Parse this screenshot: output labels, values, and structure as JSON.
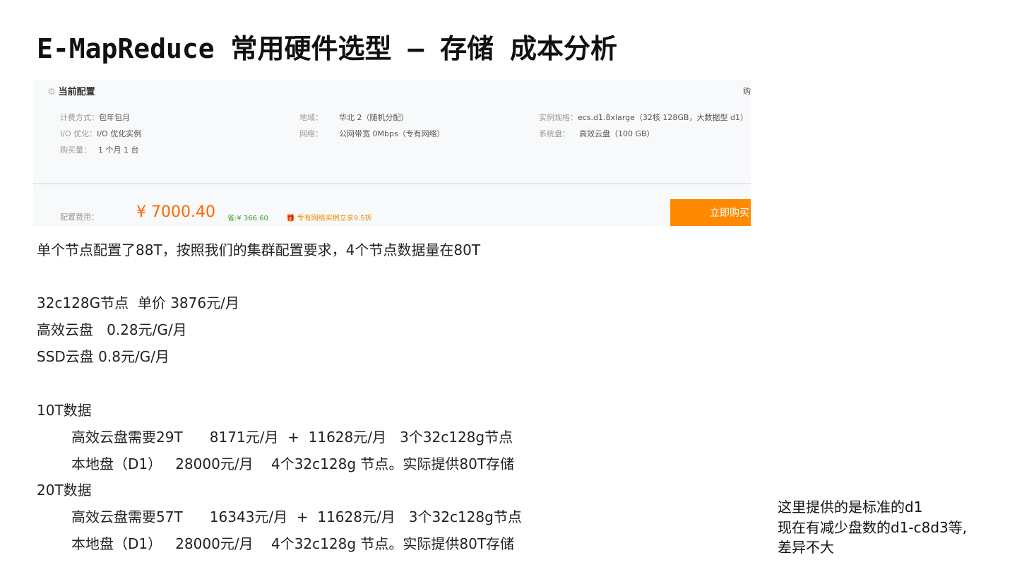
{
  "title": "E-MapReduce 常用硬件选型 – 存储 成本分析",
  "config": {
    "header": "当前配置",
    "billing_label": "计费方式：",
    "billing_value": "包年包月",
    "io_label": "I/O 优化：",
    "io_value": "I/O 优化实例",
    "qty_label": "购买量：",
    "qty_value": "1 个月 1 台",
    "region_label": "地域：",
    "region_value": "华北 2（随机分配）",
    "network_label": "网络：",
    "network_value": "公网带宽 0Mbps（专有网络）",
    "spec_label": "实例规格：",
    "spec_value": "ecs.d1.8xlarge（32核 128GB，大数据型 d1）",
    "sysdisk_label": "系统盘：",
    "sysdisk_value": "高效云盘（100 GB）",
    "buy_right": "购",
    "fee_label": "配置费用：",
    "price": "¥ 7000.40",
    "save": "省:¥ 366.60",
    "promo": "专有网络实例立享9.5折",
    "buy_button": "立即购买"
  },
  "lines": [
    "单个节点配置了88T，按照我们的集群配置要求，4个节点数据量在80T",
    "32c128G节点  单价 3876元/月",
    "高效云盘   0.28元/G/月",
    "SSD云盘 0.8元/G/月",
    "10T数据",
    "高效云盘需要29T      8171元/月  +  11628元/月   3个32c128g节点",
    "本地盘（D1）   28000元/月    4个32c128g 节点。实际提供80T存储",
    "20T数据",
    "高效云盘需要57T      16343元/月  +  11628元/月   3个32c128g节点",
    "本地盘（D1）   28000元/月    4个32c128g 节点。实际提供80T存储"
  ],
  "note": [
    "这里提供的是标准的d1",
    "现在有减少盘数的d1-c8d3等,",
    "差异不大"
  ]
}
